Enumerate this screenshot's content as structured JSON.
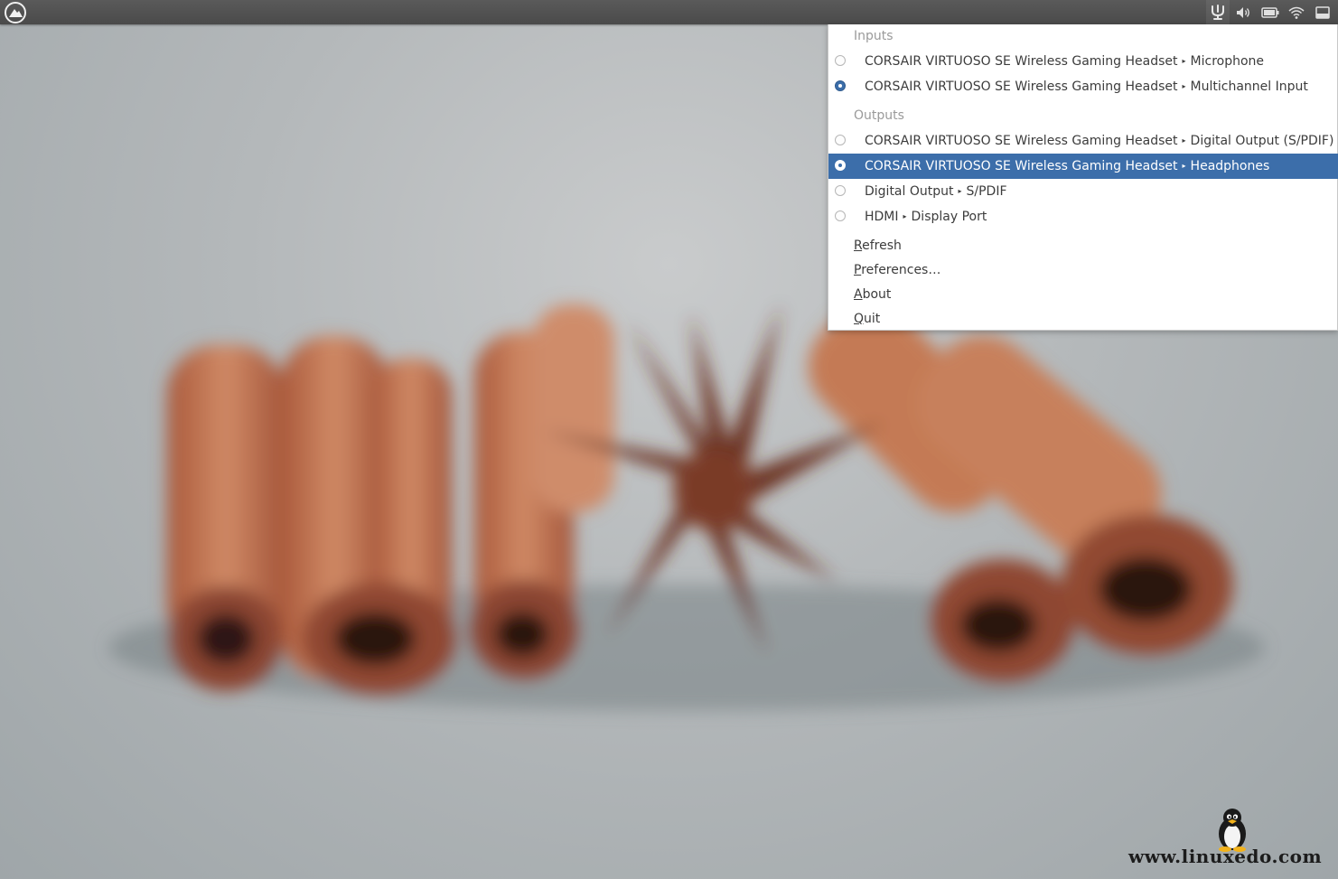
{
  "panel": {
    "launcher_icon": "distro-logo-icon",
    "tray_icons": [
      "audio-switcher-icon",
      "volume-icon",
      "battery-icon",
      "wifi-icon",
      "window-icon"
    ]
  },
  "menu": {
    "inputs_header": "Inputs",
    "inputs": [
      {
        "device": "CORSAIR VIRTUOSO SE Wireless Gaming Headset",
        "port": "Microphone",
        "selected": false
      },
      {
        "device": "CORSAIR VIRTUOSO SE Wireless Gaming Headset",
        "port": "Multichannel Input",
        "selected": true
      }
    ],
    "outputs_header": "Outputs",
    "outputs": [
      {
        "device": "CORSAIR VIRTUOSO SE Wireless Gaming Headset",
        "port": "Digital Output (S/PDIF)",
        "selected": false
      },
      {
        "device": "CORSAIR VIRTUOSO SE Wireless Gaming Headset",
        "port": "Headphones",
        "selected": true,
        "highlighted": true
      },
      {
        "device": "Digital Output",
        "port": "S/PDIF",
        "selected": false
      },
      {
        "device": "HDMI",
        "port": "Display Port",
        "selected": false
      }
    ],
    "actions": [
      {
        "mnemonic": "R",
        "rest": "efresh"
      },
      {
        "mnemonic": "P",
        "rest": "references…"
      },
      {
        "mnemonic": "A",
        "rest": "bout"
      },
      {
        "mnemonic": "Q",
        "rest": "uit"
      }
    ],
    "accent_color": "#3c6eaa"
  },
  "watermark": {
    "text": "www.linuxedo.com",
    "mascot_icon": "tux-penguin-icon"
  }
}
